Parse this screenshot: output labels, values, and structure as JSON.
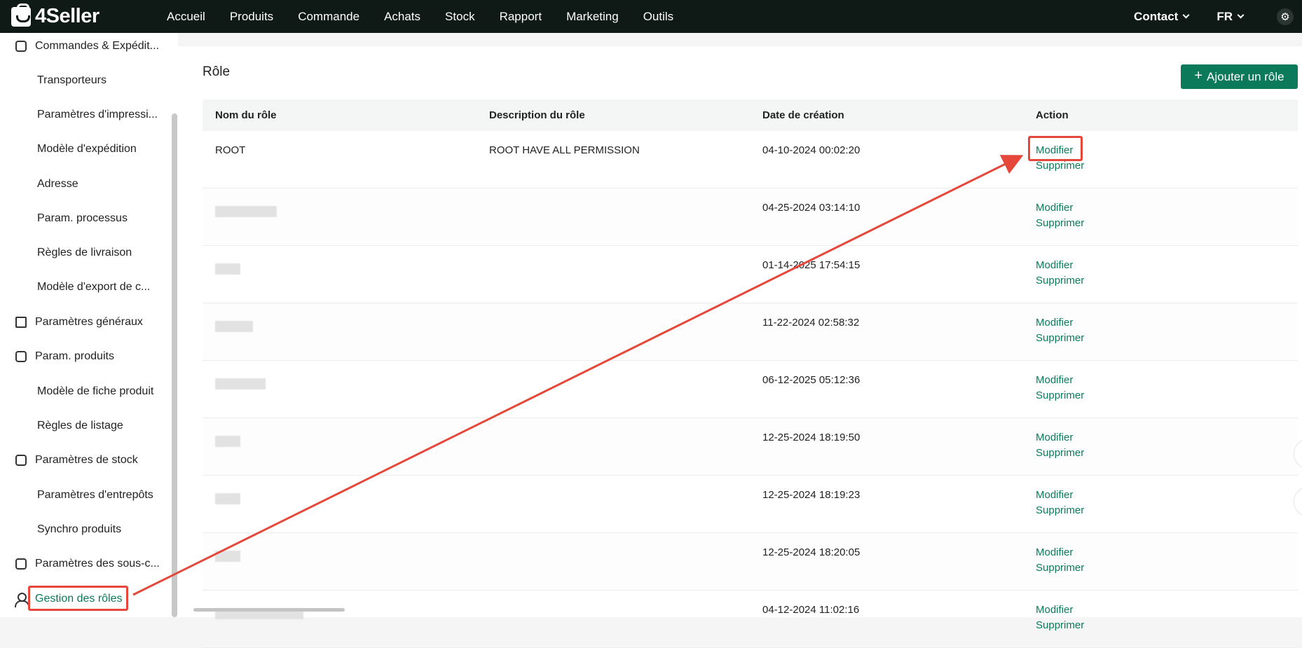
{
  "brand": {
    "name": "4Seller"
  },
  "topnav": {
    "items": [
      "Accueil",
      "Produits",
      "Commande",
      "Achats",
      "Stock",
      "Rapport",
      "Marketing",
      "Outils"
    ],
    "contact": "Contact",
    "language": "FR",
    "settings_icon": "gear-icon"
  },
  "sidebar": {
    "items": [
      {
        "label": "Commandes & Expédit...",
        "type": "group",
        "icon": "clipboard-icon"
      },
      {
        "label": "Transporteurs",
        "type": "sub"
      },
      {
        "label": "Paramètres d'impressi...",
        "type": "sub"
      },
      {
        "label": "Modèle d'expédition",
        "type": "sub"
      },
      {
        "label": "Adresse",
        "type": "sub"
      },
      {
        "label": "Param. processus",
        "type": "sub"
      },
      {
        "label": "Règles de livraison",
        "type": "sub"
      },
      {
        "label": "Modèle d'export de c...",
        "type": "sub"
      },
      {
        "label": "Paramètres généraux",
        "type": "group",
        "icon": "printer-icon"
      },
      {
        "label": "Param. produits",
        "type": "group",
        "icon": "upload-box-icon"
      },
      {
        "label": "Modèle de fiche produit",
        "type": "sub"
      },
      {
        "label": "Règles de listage",
        "type": "sub"
      },
      {
        "label": "Paramètres de stock",
        "type": "group",
        "icon": "warehouse-icon"
      },
      {
        "label": "Paramètres d'entrepôts",
        "type": "sub"
      },
      {
        "label": "Synchro produits",
        "type": "sub"
      },
      {
        "label": "Paramètres des sous-c...",
        "type": "group",
        "icon": "badge-icon"
      },
      {
        "label": "Gestion des rôles",
        "type": "group",
        "icon": "user-icon",
        "active": true
      }
    ]
  },
  "main": {
    "title": "Rôle",
    "add_button": "Ajouter un rôle",
    "table": {
      "headers": [
        "Nom du rôle",
        "Description du rôle",
        "Date de création",
        "Action"
      ],
      "rows": [
        {
          "name": "ROOT",
          "description": "ROOT HAVE ALL PERMISSION",
          "date": "04-10-2024 00:02:20"
        },
        {
          "name": "",
          "description": "",
          "date": "04-25-2024 03:14:10"
        },
        {
          "name": "",
          "description": "",
          "date": "01-14-2025 17:54:15"
        },
        {
          "name": "",
          "description": "",
          "date": "11-22-2024 02:58:32"
        },
        {
          "name": "",
          "description": "",
          "date": "06-12-2025 05:12:36"
        },
        {
          "name": "",
          "description": "",
          "date": "12-25-2024 18:19:50"
        },
        {
          "name": "",
          "description": "",
          "date": "12-25-2024 18:19:23"
        },
        {
          "name": "",
          "description": "",
          "date": "12-25-2024 18:20:05"
        },
        {
          "name": "",
          "description": "",
          "date": "04-12-2024 11:02:16"
        }
      ],
      "action_edit": "Modifier",
      "action_delete": "Supprimer"
    }
  },
  "colors": {
    "accent": "#0b7a5a",
    "topbar": "#0f1a17",
    "annotation": "#e5483b"
  }
}
